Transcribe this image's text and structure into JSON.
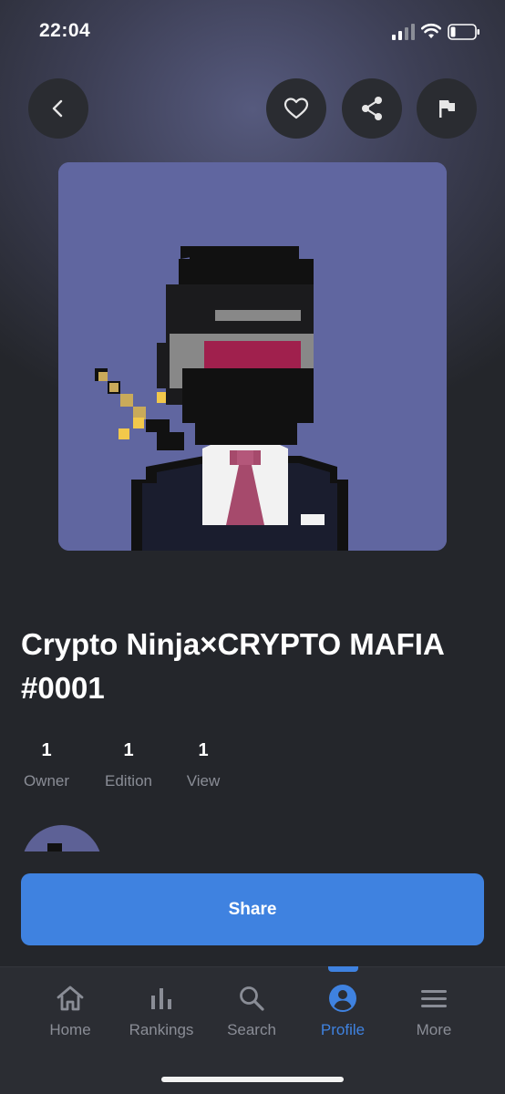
{
  "status_bar": {
    "time": "22:04"
  },
  "header": {
    "back_icon": "chevron-left-icon",
    "favorite_icon": "heart-icon",
    "share_icon": "share-icon",
    "report_icon": "flag-icon"
  },
  "nft": {
    "title": "Crypto Ninja×CRYPTO MAFIA #0001",
    "stats": [
      {
        "value": "1",
        "label": "Owner"
      },
      {
        "value": "1",
        "label": "Edition"
      },
      {
        "value": "1",
        "label": "View"
      }
    ]
  },
  "actions": {
    "share_label": "Share"
  },
  "tabs": [
    {
      "label": "Home",
      "icon": "home-icon"
    },
    {
      "label": "Rankings",
      "icon": "bar-chart-icon"
    },
    {
      "label": "Search",
      "icon": "search-icon"
    },
    {
      "label": "Profile",
      "icon": "profile-icon",
      "active": true
    },
    {
      "label": "More",
      "icon": "menu-icon"
    }
  ],
  "colors": {
    "accent": "#3f82e0",
    "background": "#24262b",
    "artwork_bg": "#6066a0"
  }
}
